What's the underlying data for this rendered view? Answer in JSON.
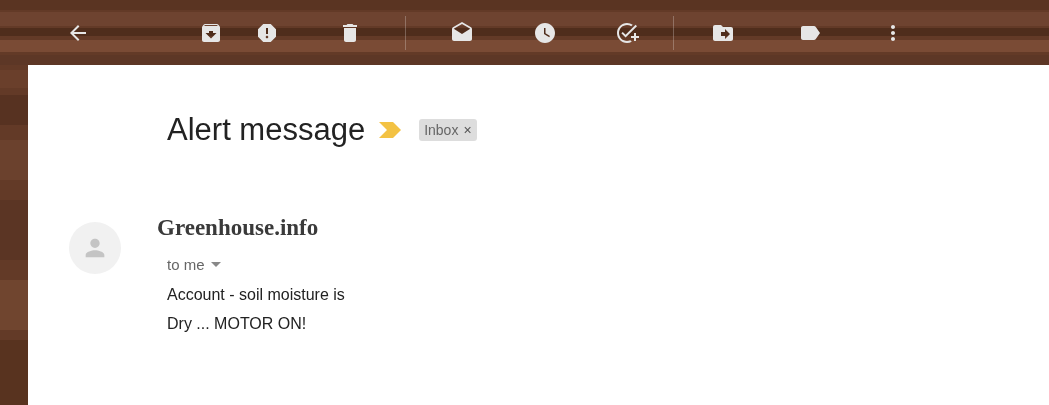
{
  "message": {
    "subject": "Alert message",
    "important": true,
    "labels": [
      {
        "name": "Inbox",
        "remove": "×"
      }
    ],
    "sender": "Greenhouse.info",
    "recipient": "to me",
    "body": [
      "Account - soil moisture is",
      "Dry ... MOTOR ON!"
    ]
  }
}
